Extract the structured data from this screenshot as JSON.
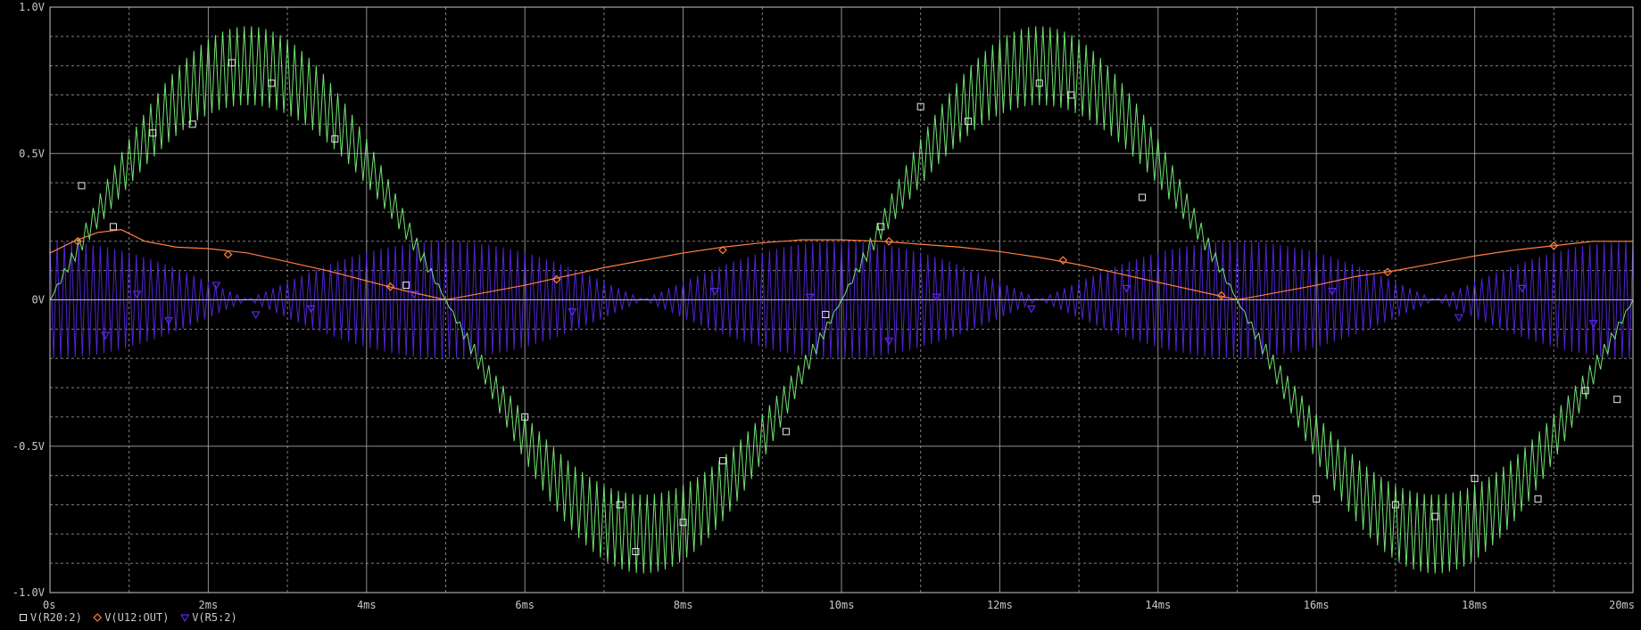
{
  "chart_data": {
    "type": "line",
    "x_unit": "ms",
    "xlim": [
      0,
      20
    ],
    "ylim": [
      -1.0,
      1.0
    ],
    "grid": true,
    "x_ticks": [
      "0s",
      "2ms",
      "4ms",
      "6ms",
      "8ms",
      "10ms",
      "12ms",
      "14ms",
      "16ms",
      "18ms",
      "20ms"
    ],
    "x_tick_values": [
      0,
      2,
      4,
      6,
      8,
      10,
      12,
      14,
      16,
      18,
      20
    ],
    "y_ticks": [
      "1.0V",
      "0.5V",
      "0V",
      "-0.5V",
      "-1.0V"
    ],
    "y_tick_values": [
      1.0,
      0.5,
      0,
      -0.5,
      -1.0
    ],
    "legend_position": "bottom-left",
    "series": [
      {
        "name": "V(R20:2)",
        "marker": "square",
        "color": "#7CFC7C",
        "style": "am-band",
        "envelope_amplitude": 0.8,
        "ripple_amplitude": 0.135,
        "envelope_period_ms": 10,
        "carrier_cycles": 220,
        "marker_points": [
          [
            0.4,
            0.39
          ],
          [
            0.8,
            0.25
          ],
          [
            1.3,
            0.57
          ],
          [
            1.8,
            0.6
          ],
          [
            2.3,
            0.81
          ],
          [
            2.8,
            0.74
          ],
          [
            3.6,
            0.55
          ],
          [
            4.5,
            0.05
          ],
          [
            6.0,
            -0.4
          ],
          [
            7.2,
            -0.7
          ],
          [
            7.4,
            -0.86
          ],
          [
            8.0,
            -0.76
          ],
          [
            8.5,
            -0.55
          ],
          [
            9.3,
            -0.45
          ],
          [
            9.8,
            -0.05
          ],
          [
            10.5,
            0.25
          ],
          [
            11.0,
            0.66
          ],
          [
            11.6,
            0.61
          ],
          [
            12.5,
            0.74
          ],
          [
            12.9,
            0.7
          ],
          [
            13.8,
            0.35
          ],
          [
            16.0,
            -0.68
          ],
          [
            17.0,
            -0.7
          ],
          [
            17.5,
            -0.74
          ],
          [
            18.0,
            -0.61
          ],
          [
            18.8,
            -0.68
          ],
          [
            19.4,
            -0.31
          ],
          [
            19.8,
            -0.34
          ]
        ]
      },
      {
        "name": "V(U12:OUT)",
        "marker": "diamond",
        "color": "#FF7F3F",
        "style": "line",
        "points": [
          [
            0,
            0.16
          ],
          [
            0.3,
            0.2
          ],
          [
            0.6,
            0.23
          ],
          [
            0.9,
            0.24
          ],
          [
            1.2,
            0.2
          ],
          [
            1.6,
            0.18
          ],
          [
            2.0,
            0.175
          ],
          [
            2.5,
            0.16
          ],
          [
            3.0,
            0.13
          ],
          [
            3.5,
            0.1
          ],
          [
            4.0,
            0.065
          ],
          [
            4.5,
            0.03
          ],
          [
            5.0,
            0.0
          ],
          [
            5.5,
            0.025
          ],
          [
            6.0,
            0.05
          ],
          [
            6.5,
            0.08
          ],
          [
            7.0,
            0.11
          ],
          [
            7.5,
            0.135
          ],
          [
            8.0,
            0.16
          ],
          [
            8.5,
            0.18
          ],
          [
            9.0,
            0.195
          ],
          [
            9.5,
            0.205
          ],
          [
            10.0,
            0.205
          ],
          [
            10.5,
            0.2
          ],
          [
            11.0,
            0.19
          ],
          [
            11.5,
            0.18
          ],
          [
            12.0,
            0.165
          ],
          [
            12.5,
            0.145
          ],
          [
            13.0,
            0.12
          ],
          [
            13.5,
            0.09
          ],
          [
            14.0,
            0.06
          ],
          [
            14.5,
            0.03
          ],
          [
            15.0,
            0.0
          ],
          [
            15.5,
            0.025
          ],
          [
            16.0,
            0.05
          ],
          [
            16.5,
            0.08
          ],
          [
            17.0,
            0.1
          ],
          [
            17.5,
            0.125
          ],
          [
            18.0,
            0.15
          ],
          [
            18.5,
            0.17
          ],
          [
            19.0,
            0.185
          ],
          [
            19.5,
            0.2
          ],
          [
            20.0,
            0.2
          ]
        ],
        "marker_points": [
          [
            0.35,
            0.2
          ],
          [
            2.25,
            0.155
          ],
          [
            4.3,
            0.045
          ],
          [
            6.4,
            0.07
          ],
          [
            8.5,
            0.17
          ],
          [
            10.6,
            0.2
          ],
          [
            12.8,
            0.135
          ],
          [
            14.8,
            0.015
          ],
          [
            16.9,
            0.095
          ],
          [
            19.0,
            0.185
          ]
        ]
      },
      {
        "name": "V(R5:2)",
        "marker": "triangle-down",
        "color": "#5A28E6",
        "style": "am-band",
        "envelope_amplitude": 0.2,
        "envelope_period_ms": 10,
        "carrier_cycles": 220,
        "marker_points": [
          [
            0.7,
            -0.12
          ],
          [
            1.1,
            0.02
          ],
          [
            1.5,
            -0.07
          ],
          [
            2.1,
            0.05
          ],
          [
            2.6,
            -0.05
          ],
          [
            3.3,
            -0.03
          ],
          [
            4.6,
            0.02
          ],
          [
            6.6,
            -0.04
          ],
          [
            8.4,
            0.03
          ],
          [
            9.6,
            0.01
          ],
          [
            10.6,
            -0.14
          ],
          [
            11.2,
            0.01
          ],
          [
            12.4,
            -0.03
          ],
          [
            13.6,
            0.04
          ],
          [
            16.2,
            0.03
          ],
          [
            17.8,
            -0.06
          ],
          [
            18.6,
            0.04
          ],
          [
            19.5,
            -0.08
          ]
        ]
      }
    ]
  },
  "colors": {
    "background": "#000000",
    "grid_major": "#a8a8a8",
    "grid_minor": "#a8a8a8",
    "axis": "#c8c8c8",
    "text": "#c8c8c8"
  }
}
